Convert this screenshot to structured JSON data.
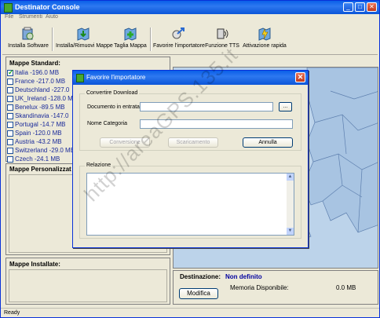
{
  "window": {
    "title": "Destinator Console"
  },
  "menu": {
    "items": [
      "File",
      "Strumenti",
      "Aiuto"
    ]
  },
  "toolbar": {
    "install_software": "Installa Software",
    "install_remove_maps": "Installa/Rimuovi Mappe",
    "cut_map": "Taglia Mappa",
    "favor_importer": "Favorire l'importatore",
    "tts_function": "Funzione TTS",
    "quick_activation": "Attivazione rapida"
  },
  "standard_maps": {
    "title": "Mappe Standard:",
    "items": [
      {
        "label": "Italia -196.0 MB",
        "checked": true
      },
      {
        "label": "France -217.0 MB",
        "checked": false
      },
      {
        "label": "Deutschland -227.0",
        "checked": false
      },
      {
        "label": "UK_Ireland -128.0 M",
        "checked": false
      },
      {
        "label": "Benelux -89.5 MB",
        "checked": false
      },
      {
        "label": "Skandinavia -147.0",
        "checked": false
      },
      {
        "label": "Portugal -14.7 MB",
        "checked": false
      },
      {
        "label": "Spain -120.0 MB",
        "checked": false
      },
      {
        "label": "Austria -43.2 MB",
        "checked": false
      },
      {
        "label": "Switzerland -29.0 MB",
        "checked": false
      },
      {
        "label": "Czech -24.1 MB",
        "checked": false
      }
    ]
  },
  "personal_maps": {
    "title": "Mappe Personalizzat"
  },
  "installed_maps": {
    "title": "Mappe Installate:"
  },
  "destination": {
    "label": "Destinazione:",
    "value": "Non definito",
    "memory_label": "Memoria Disponibile:",
    "memory_value": "0.0 MB",
    "modify_button": "Modifica"
  },
  "status": {
    "text": "Ready"
  },
  "dialog": {
    "title": "Favorire l'importatore",
    "group_download": "Convertire  Download",
    "input_doc_label": "Documento in entrata",
    "input_doc_value": "",
    "browse_button": "...",
    "category_label": "Nome Categoria",
    "category_value": "",
    "convert_button": "Conversione",
    "download_button": "Scaricamento",
    "cancel_button": "Annulla",
    "report_label": "Relazione"
  },
  "watermark": "http://areaGPS.135.it"
}
